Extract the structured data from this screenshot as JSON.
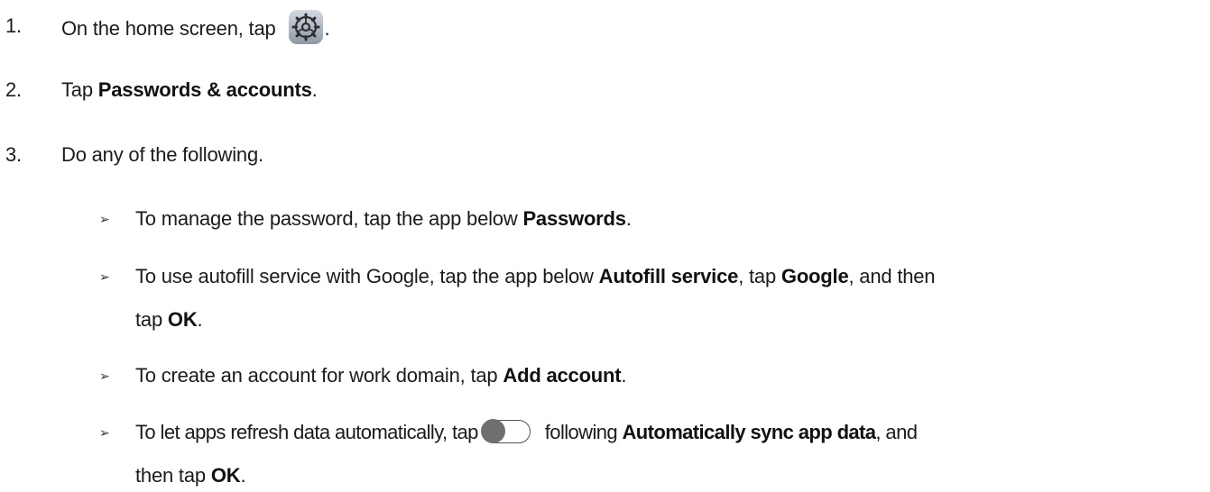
{
  "steps": [
    {
      "number": "1.",
      "text_before_icon": "On the home screen, tap",
      "icon": "settings-gear-icon",
      "text_after_icon": "."
    },
    {
      "number": "2.",
      "prefix": "Tap ",
      "bold": "Passwords & accounts",
      "suffix": "."
    },
    {
      "number": "3.",
      "text": "Do any of the following."
    }
  ],
  "bullets": [
    {
      "prefix": "To manage the password, tap the app below ",
      "bold": "Passwords",
      "suffix": "."
    },
    {
      "prefix": "To use autofill service with Google, tap the app below ",
      "bold1": "Autofill service",
      "middle1": ", tap ",
      "bold2": "Google",
      "middle2": ", and then",
      "line2_prefix": "tap ",
      "bold3": "OK",
      "line2_suffix": "."
    },
    {
      "prefix": "To create an account for work domain, tap ",
      "bold": "Add account",
      "suffix": "."
    },
    {
      "prefix": "To let apps refresh data automatically, tap",
      "icon": "toggle-switch-off-icon",
      "after_icon": "following ",
      "bold": "Automatically sync app data",
      "suffix": ", and",
      "line2_prefix": "then tap ",
      "bold2": "OK",
      "line2_suffix": "."
    }
  ],
  "bullet_glyph": "➢",
  "colors": {
    "text": "#1b1b1b",
    "gear_bg_top": "#d3dae1",
    "gear_bg_bottom": "#8d99a6",
    "toggle_knob": "#6f6f6f"
  }
}
